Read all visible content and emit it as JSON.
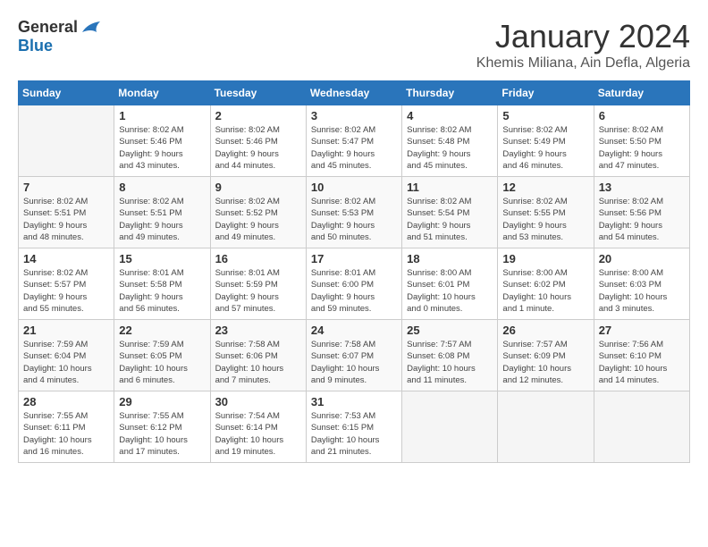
{
  "logo": {
    "general": "General",
    "blue": "Blue"
  },
  "title": "January 2024",
  "location": "Khemis Miliana, Ain Defla, Algeria",
  "weekdays": [
    "Sunday",
    "Monday",
    "Tuesday",
    "Wednesday",
    "Thursday",
    "Friday",
    "Saturday"
  ],
  "weeks": [
    [
      {
        "num": "",
        "info": ""
      },
      {
        "num": "1",
        "info": "Sunrise: 8:02 AM\nSunset: 5:46 PM\nDaylight: 9 hours\nand 43 minutes."
      },
      {
        "num": "2",
        "info": "Sunrise: 8:02 AM\nSunset: 5:46 PM\nDaylight: 9 hours\nand 44 minutes."
      },
      {
        "num": "3",
        "info": "Sunrise: 8:02 AM\nSunset: 5:47 PM\nDaylight: 9 hours\nand 45 minutes."
      },
      {
        "num": "4",
        "info": "Sunrise: 8:02 AM\nSunset: 5:48 PM\nDaylight: 9 hours\nand 45 minutes."
      },
      {
        "num": "5",
        "info": "Sunrise: 8:02 AM\nSunset: 5:49 PM\nDaylight: 9 hours\nand 46 minutes."
      },
      {
        "num": "6",
        "info": "Sunrise: 8:02 AM\nSunset: 5:50 PM\nDaylight: 9 hours\nand 47 minutes."
      }
    ],
    [
      {
        "num": "7",
        "info": "Sunrise: 8:02 AM\nSunset: 5:51 PM\nDaylight: 9 hours\nand 48 minutes."
      },
      {
        "num": "8",
        "info": "Sunrise: 8:02 AM\nSunset: 5:51 PM\nDaylight: 9 hours\nand 49 minutes."
      },
      {
        "num": "9",
        "info": "Sunrise: 8:02 AM\nSunset: 5:52 PM\nDaylight: 9 hours\nand 49 minutes."
      },
      {
        "num": "10",
        "info": "Sunrise: 8:02 AM\nSunset: 5:53 PM\nDaylight: 9 hours\nand 50 minutes."
      },
      {
        "num": "11",
        "info": "Sunrise: 8:02 AM\nSunset: 5:54 PM\nDaylight: 9 hours\nand 51 minutes."
      },
      {
        "num": "12",
        "info": "Sunrise: 8:02 AM\nSunset: 5:55 PM\nDaylight: 9 hours\nand 53 minutes."
      },
      {
        "num": "13",
        "info": "Sunrise: 8:02 AM\nSunset: 5:56 PM\nDaylight: 9 hours\nand 54 minutes."
      }
    ],
    [
      {
        "num": "14",
        "info": "Sunrise: 8:02 AM\nSunset: 5:57 PM\nDaylight: 9 hours\nand 55 minutes."
      },
      {
        "num": "15",
        "info": "Sunrise: 8:01 AM\nSunset: 5:58 PM\nDaylight: 9 hours\nand 56 minutes."
      },
      {
        "num": "16",
        "info": "Sunrise: 8:01 AM\nSunset: 5:59 PM\nDaylight: 9 hours\nand 57 minutes."
      },
      {
        "num": "17",
        "info": "Sunrise: 8:01 AM\nSunset: 6:00 PM\nDaylight: 9 hours\nand 59 minutes."
      },
      {
        "num": "18",
        "info": "Sunrise: 8:00 AM\nSunset: 6:01 PM\nDaylight: 10 hours\nand 0 minutes."
      },
      {
        "num": "19",
        "info": "Sunrise: 8:00 AM\nSunset: 6:02 PM\nDaylight: 10 hours\nand 1 minute."
      },
      {
        "num": "20",
        "info": "Sunrise: 8:00 AM\nSunset: 6:03 PM\nDaylight: 10 hours\nand 3 minutes."
      }
    ],
    [
      {
        "num": "21",
        "info": "Sunrise: 7:59 AM\nSunset: 6:04 PM\nDaylight: 10 hours\nand 4 minutes."
      },
      {
        "num": "22",
        "info": "Sunrise: 7:59 AM\nSunset: 6:05 PM\nDaylight: 10 hours\nand 6 minutes."
      },
      {
        "num": "23",
        "info": "Sunrise: 7:58 AM\nSunset: 6:06 PM\nDaylight: 10 hours\nand 7 minutes."
      },
      {
        "num": "24",
        "info": "Sunrise: 7:58 AM\nSunset: 6:07 PM\nDaylight: 10 hours\nand 9 minutes."
      },
      {
        "num": "25",
        "info": "Sunrise: 7:57 AM\nSunset: 6:08 PM\nDaylight: 10 hours\nand 11 minutes."
      },
      {
        "num": "26",
        "info": "Sunrise: 7:57 AM\nSunset: 6:09 PM\nDaylight: 10 hours\nand 12 minutes."
      },
      {
        "num": "27",
        "info": "Sunrise: 7:56 AM\nSunset: 6:10 PM\nDaylight: 10 hours\nand 14 minutes."
      }
    ],
    [
      {
        "num": "28",
        "info": "Sunrise: 7:55 AM\nSunset: 6:11 PM\nDaylight: 10 hours\nand 16 minutes."
      },
      {
        "num": "29",
        "info": "Sunrise: 7:55 AM\nSunset: 6:12 PM\nDaylight: 10 hours\nand 17 minutes."
      },
      {
        "num": "30",
        "info": "Sunrise: 7:54 AM\nSunset: 6:14 PM\nDaylight: 10 hours\nand 19 minutes."
      },
      {
        "num": "31",
        "info": "Sunrise: 7:53 AM\nSunset: 6:15 PM\nDaylight: 10 hours\nand 21 minutes."
      },
      {
        "num": "",
        "info": ""
      },
      {
        "num": "",
        "info": ""
      },
      {
        "num": "",
        "info": ""
      }
    ]
  ]
}
